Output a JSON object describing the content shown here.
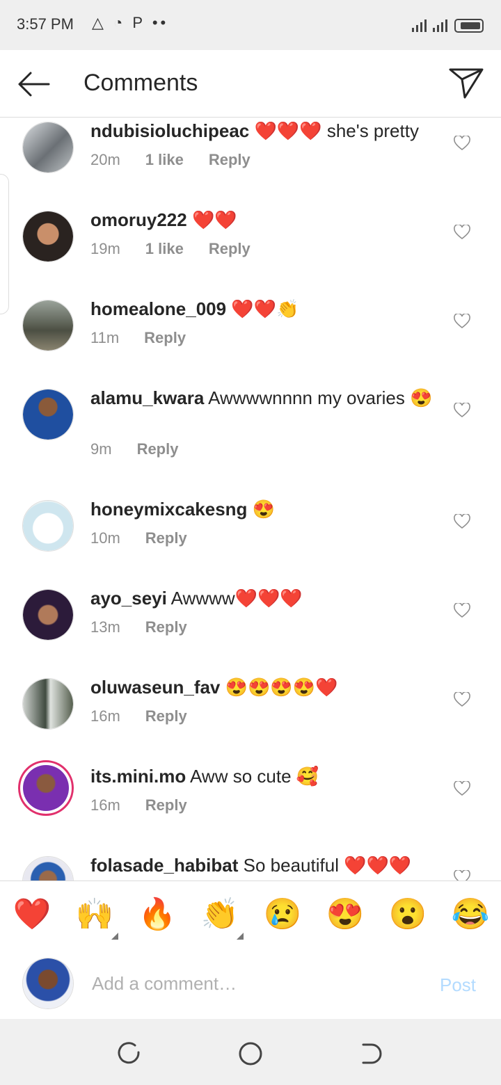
{
  "status_bar": {
    "time": "3:57 PM",
    "icons": "△ ◔ P ••"
  },
  "header": {
    "title": "Comments"
  },
  "comments": [
    {
      "username": "ndubisioluchipeac",
      "text": "❤️❤️❤️ she's pretty",
      "time": "20m",
      "likes": "1 like",
      "reply": "Reply"
    },
    {
      "username": "omoruy222",
      "text": "❤️❤️",
      "time": "19m",
      "likes": "1 like",
      "reply": "Reply"
    },
    {
      "username": "homealone_009",
      "text": "❤️❤️👏",
      "time": "11m",
      "likes": "",
      "reply": "Reply"
    },
    {
      "username": "alamu_kwara",
      "text": "Awwwwnnnn my ovaries 😍",
      "time": "9m",
      "likes": "",
      "reply": "Reply"
    },
    {
      "username": "honeymixcakesng",
      "text": "😍",
      "time": "10m",
      "likes": "",
      "reply": "Reply"
    },
    {
      "username": "ayo_seyi",
      "text": "Awwww❤️❤️❤️",
      "time": "13m",
      "likes": "",
      "reply": "Reply"
    },
    {
      "username": "oluwaseun_fav",
      "text": "😍😍😍😍❤️",
      "time": "16m",
      "likes": "",
      "reply": "Reply"
    },
    {
      "username": "its.mini.mo",
      "text": "Aww so cute 🥰",
      "time": "16m",
      "likes": "",
      "reply": "Reply"
    },
    {
      "username": "folasade_habibat",
      "text": "So beautiful ❤️❤️❤️",
      "time": "",
      "likes": "",
      "reply": ""
    }
  ],
  "reactions": [
    "❤️",
    "🙌",
    "🔥",
    "👏",
    "😢",
    "😍",
    "😮",
    "😂"
  ],
  "composer": {
    "placeholder": "Add a comment…",
    "post_label": "Post"
  },
  "colors": {
    "accent": "#0095f6",
    "post_disabled": "#b3dbff",
    "story_ring": "#e1306c"
  }
}
